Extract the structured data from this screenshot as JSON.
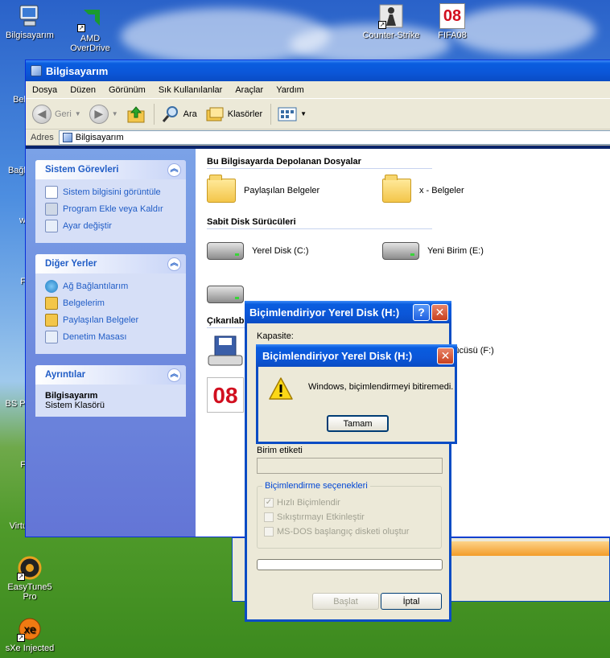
{
  "desktop": {
    "icons": [
      {
        "label": "Bilgisayarım"
      },
      {
        "label": "AMD\nOverDrive"
      },
      {
        "label": "Counter-Strike"
      },
      {
        "label": "FIFA08"
      },
      {
        "label": "EasyTune5\nPro"
      },
      {
        "label": "sXe Injected"
      }
    ],
    "partial_labels": [
      "Bel",
      "Bağl",
      "w",
      "F",
      "BS Pl",
      "F",
      "Virtu"
    ],
    "fifa_badge": "08"
  },
  "explorer": {
    "title": "Bilgisayarım",
    "menu": [
      "Dosya",
      "Düzen",
      "Görünüm",
      "Sık Kullanılanlar",
      "Araçlar",
      "Yardım"
    ],
    "toolbar": {
      "back": "Geri",
      "search": "Ara",
      "folders": "Klasörler"
    },
    "address": {
      "label": "Adres",
      "value": "Bilgisayarım"
    },
    "tasks_panel": {
      "title": "Sistem Görevleri",
      "links": [
        "Sistem bilgisini görüntüle",
        "Program Ekle veya Kaldır",
        "Ayar değiştir"
      ]
    },
    "places_panel": {
      "title": "Diğer Yerler",
      "links": [
        "Ağ Bağlantılarım",
        "Belgelerim",
        "Paylaşılan Belgeler",
        "Denetim Masası"
      ]
    },
    "details_panel": {
      "title": "Ayrıntılar",
      "name": "Bilgisayarım",
      "type": "Sistem Klasörü"
    },
    "sections": {
      "files": "Bu Bilgisayarda Depolanan Dosyalar",
      "drives": "Sabit Disk Sürücüleri",
      "removable": "Çıkarılab"
    },
    "files": [
      "Paylaşılan Belgeler",
      "x - Belgeler"
    ],
    "drives": [
      "Yerel Disk (C:)",
      "Yeni Birim (E:)"
    ],
    "removable_item": "M Sürücüsü (F:)",
    "removable_badge": "08"
  },
  "format_dialog": {
    "title": "Biçimlendiriyor Yerel Disk (H:)",
    "capacity_label": "Kapasite:",
    "volume_label": "Birim etiketi",
    "options_title": "Biçimlendirme seçenekleri",
    "options": [
      "Hızlı Biçimlendir",
      "Sıkıştırmayı Etkinleştir",
      "MS-DOS başlangıç disketi oluştur"
    ],
    "quick_checked": "✓",
    "progress": 0,
    "start_button": "Başlat",
    "cancel_button": "İptal"
  },
  "error_dialog": {
    "title": "Biçimlendiriyor Yerel Disk (H:)",
    "message": "Windows, biçimlendirmeyi bitiremedi.",
    "ok_button": "Tamam"
  },
  "colors": {
    "titlebar": "#0a5ddf",
    "left_pane": "#7ba2e7",
    "link": "#215dc6",
    "close_button": "#c8401e"
  }
}
